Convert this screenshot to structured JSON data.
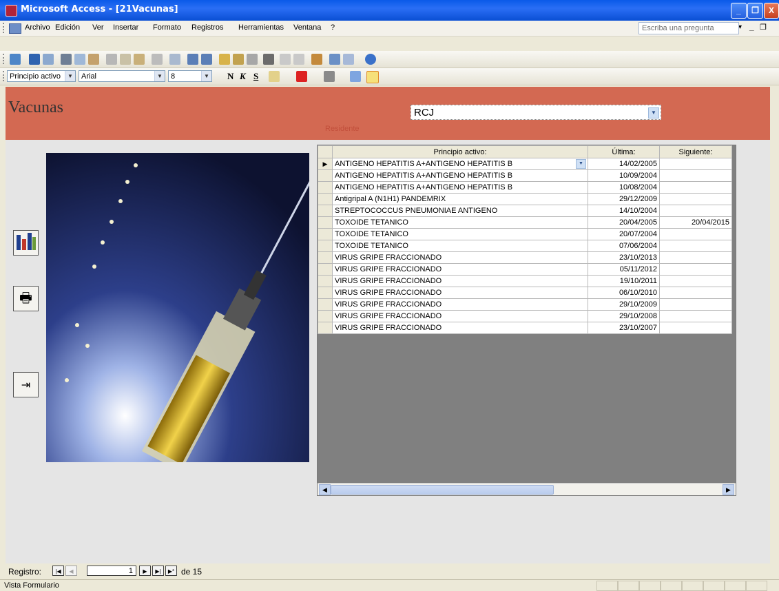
{
  "window": {
    "title": "Microsoft Access - [21Vacunas]",
    "min_label": "_",
    "max_label": "❐",
    "close_label": "X"
  },
  "menu": {
    "items": [
      "Archivo",
      "Edición",
      "Ver",
      "Insertar",
      "Formato",
      "Registros",
      "Herramientas",
      "Ventana",
      "?"
    ],
    "ask_placeholder": "Escriba una pregunta"
  },
  "format_toolbar": {
    "object_combo": "Principio activo",
    "font_combo": "Arial",
    "size_combo": "8",
    "bold": "N",
    "italic": "K",
    "underline": "S"
  },
  "form": {
    "title": "Vacunas",
    "residente_label": "Residente",
    "residente_value": "RCJ",
    "grid": {
      "columns": [
        "Principio activo:",
        "Última:",
        "Siguiente:"
      ],
      "rows": [
        {
          "principio": "ANTIGENO HEPATITIS A+ANTIGENO HEPATITIS B",
          "ultima": "14/02/2005",
          "siguiente": ""
        },
        {
          "principio": "ANTIGENO HEPATITIS A+ANTIGENO HEPATITIS B",
          "ultima": "10/09/2004",
          "siguiente": ""
        },
        {
          "principio": "ANTIGENO HEPATITIS A+ANTIGENO HEPATITIS B",
          "ultima": "10/08/2004",
          "siguiente": ""
        },
        {
          "principio": "Antigripal A (N1H1) PANDEMRIX",
          "ultima": "29/12/2009",
          "siguiente": ""
        },
        {
          "principio": "STREPTOCOCCUS PNEUMONIAE ANTIGENO",
          "ultima": "14/10/2004",
          "siguiente": ""
        },
        {
          "principio": "TOXOIDE TETANICO",
          "ultima": "20/04/2005",
          "siguiente": "20/04/2015"
        },
        {
          "principio": "TOXOIDE TETANICO",
          "ultima": "20/07/2004",
          "siguiente": ""
        },
        {
          "principio": "TOXOIDE TETANICO",
          "ultima": "07/06/2004",
          "siguiente": ""
        },
        {
          "principio": "VIRUS GRIPE FRACCIONADO",
          "ultima": "23/10/2013",
          "siguiente": ""
        },
        {
          "principio": "VIRUS GRIPE FRACCIONADO",
          "ultima": "05/11/2012",
          "siguiente": ""
        },
        {
          "principio": "VIRUS GRIPE FRACCIONADO",
          "ultima": "19/10/2011",
          "siguiente": ""
        },
        {
          "principio": "VIRUS GRIPE FRACCIONADO",
          "ultima": "06/10/2010",
          "siguiente": ""
        },
        {
          "principio": "VIRUS GRIPE FRACCIONADO",
          "ultima": "29/10/2009",
          "siguiente": ""
        },
        {
          "principio": "VIRUS GRIPE FRACCIONADO",
          "ultima": "29/10/2008",
          "siguiente": ""
        },
        {
          "principio": "VIRUS GRIPE FRACCIONADO",
          "ultima": "23/10/2007",
          "siguiente": ""
        }
      ]
    }
  },
  "navigation": {
    "label": "Registro:",
    "current": "1",
    "of_label": "de 15"
  },
  "status": {
    "text": "Vista Formulario"
  },
  "colors": {
    "header": "#d36952",
    "titlebar": "#0a5ae8",
    "form_bg": "#e5e5e5",
    "grid_bg": "#808080"
  }
}
